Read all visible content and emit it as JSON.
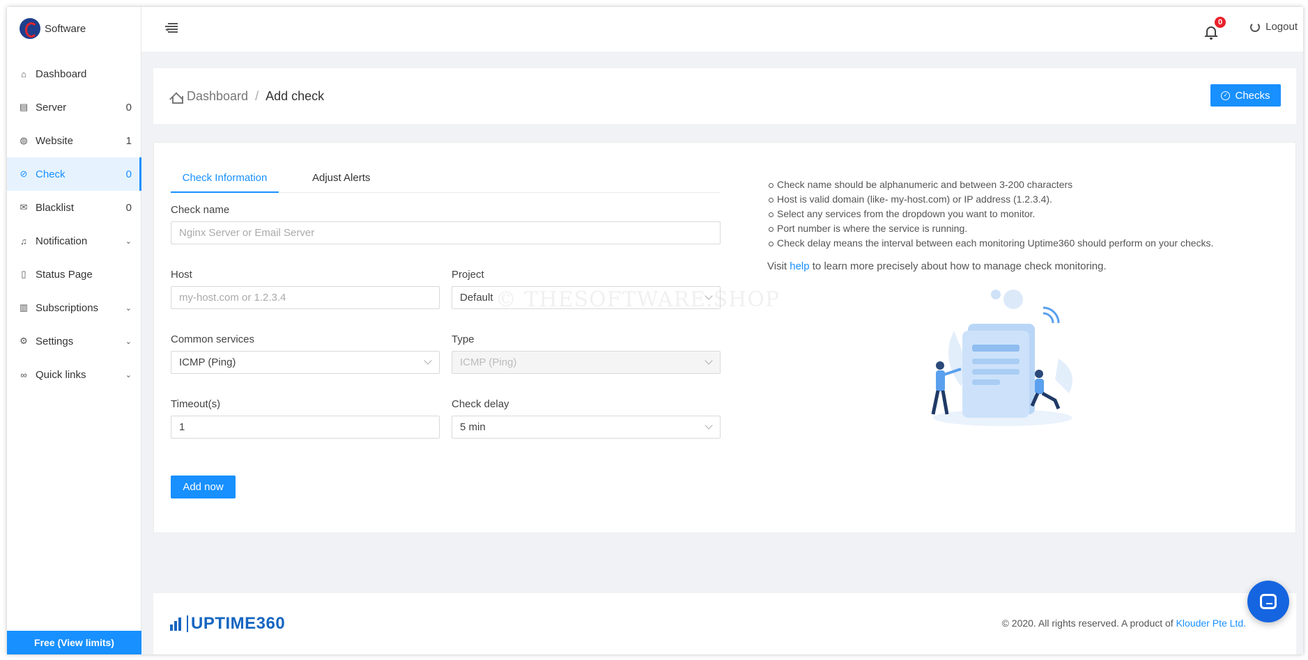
{
  "brand": {
    "name": "Software"
  },
  "sidebar": {
    "items": [
      {
        "label": "Dashboard",
        "icon": "home-icon",
        "count": ""
      },
      {
        "label": "Server",
        "icon": "server-icon",
        "count": "0"
      },
      {
        "label": "Website",
        "icon": "globe-icon",
        "count": "1"
      },
      {
        "label": "Check",
        "icon": "check-circle-icon",
        "count": "0",
        "active": true
      },
      {
        "label": "Blacklist",
        "icon": "mail-icon",
        "count": "0"
      },
      {
        "label": "Notification",
        "icon": "bell-icon",
        "count": "",
        "expandable": true
      },
      {
        "label": "Status Page",
        "icon": "page-icon",
        "count": ""
      },
      {
        "label": "Subscriptions",
        "icon": "chart-icon",
        "count": "",
        "expandable": true
      },
      {
        "label": "Settings",
        "icon": "gear-icon",
        "count": "",
        "expandable": true
      },
      {
        "label": "Quick links",
        "icon": "link-icon",
        "count": "",
        "expandable": true
      }
    ],
    "free_button": "Free (View limits)"
  },
  "header": {
    "notification_count": "0",
    "logout_label": "Logout"
  },
  "breadcrumb": {
    "root": "Dashboard",
    "separator": "/",
    "current": "Add check",
    "checks_button": "Checks"
  },
  "form": {
    "tabs": [
      "Check Information",
      "Adjust Alerts"
    ],
    "check_name": {
      "label": "Check name",
      "placeholder": "Nginx Server or Email Server"
    },
    "host": {
      "label": "Host",
      "placeholder": "my-host.com or 1.2.3.4"
    },
    "project": {
      "label": "Project",
      "value": "Default"
    },
    "common_services": {
      "label": "Common services",
      "value": "ICMP (Ping)"
    },
    "type": {
      "label": "Type",
      "value": "ICMP (Ping)"
    },
    "timeout": {
      "label": "Timeout(s)",
      "value": "1"
    },
    "check_delay": {
      "label": "Check delay",
      "value": "5 min"
    },
    "submit_label": "Add now"
  },
  "tips": {
    "items": [
      "Check name should be alphanumeric and between 3-200 characters",
      "Host is valid domain (like- my-host.com) or IP address (1.2.3.4).",
      "Select any services from the dropdown you want to monitor.",
      "Port number is where the service is running.",
      "Check delay means the interval between each monitoring Uptime360 should perform on your checks."
    ],
    "visit_prefix": "Visit ",
    "visit_link": "help",
    "visit_suffix": " to learn more precisely about how to manage check monitoring."
  },
  "watermark": "© THESOFTWARE.SHOP",
  "footer": {
    "logo_text": "UPTIME360",
    "copyright_prefix": "© 2020. All rights reserved. A product of ",
    "copyright_link": "Klouder Pte Ltd."
  },
  "colors": {
    "accent": "#1890ff",
    "badge": "#e8212a",
    "brand_blue": "#1565c0"
  }
}
